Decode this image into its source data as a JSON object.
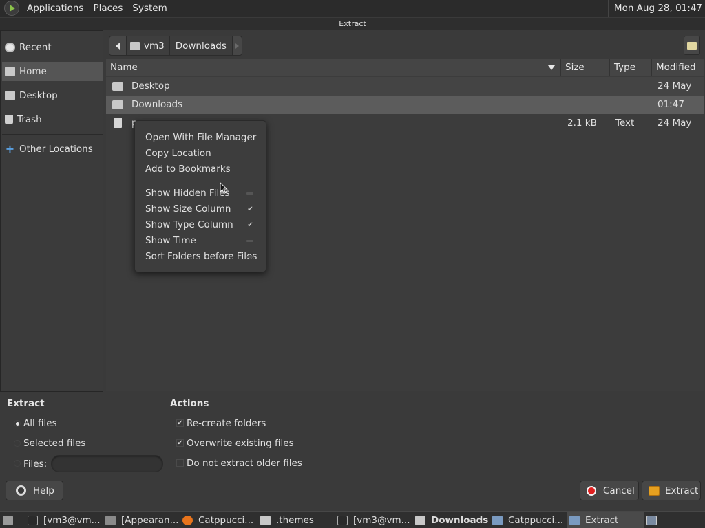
{
  "top_panel": {
    "menus": [
      "Applications",
      "Places",
      "System"
    ],
    "clock": "Mon Aug 28, 01:47"
  },
  "window": {
    "title": "Extract"
  },
  "sidebar": {
    "items": [
      {
        "label": "Recent",
        "icon": "recent-clock-icon"
      },
      {
        "label": "Home",
        "icon": "home-folder-icon",
        "selected": true
      },
      {
        "label": "Desktop",
        "icon": "desktop-folder-icon"
      },
      {
        "label": "Trash",
        "icon": "trash-icon"
      },
      {
        "label": "Other Locations",
        "icon": "plus-icon"
      }
    ]
  },
  "pathbar": {
    "segments": [
      "vm3",
      "Downloads"
    ]
  },
  "filelist": {
    "columns": [
      "Name",
      "Size",
      "Type",
      "Modified"
    ],
    "rows": [
      {
        "name": "Desktop",
        "size": "",
        "type": "",
        "modified": "24 May",
        "icon": "folder-icon"
      },
      {
        "name": "Downloads",
        "size": "",
        "type": "",
        "modified": "01:47",
        "icon": "folder-icon",
        "selected": true
      },
      {
        "name": "p...",
        "size": "2.1 kB",
        "type": "Text",
        "modified": "24 May",
        "icon": "text-file-icon"
      }
    ]
  },
  "context_menu": {
    "items": [
      {
        "label": "Open With File Manager"
      },
      {
        "label": "Copy Location"
      },
      {
        "label": "Add to Bookmarks"
      },
      {
        "label": "Show Hidden Files",
        "checked": false
      },
      {
        "label": "Show Size Column",
        "checked": true
      },
      {
        "label": "Show Type Column",
        "checked": true
      },
      {
        "label": "Show Time",
        "checked": false
      },
      {
        "label": "Sort Folders before Files",
        "checked": false
      }
    ]
  },
  "extract_options": {
    "title": "Extract",
    "all_files": "All files",
    "selected_files": "Selected files",
    "files_label": "Files:",
    "files_value": "",
    "selected": "all_files"
  },
  "actions": {
    "title": "Actions",
    "recreate_folders": "Re-create folders",
    "overwrite": "Overwrite existing files",
    "no_older": "Do not extract older files",
    "recreate_checked": true,
    "overwrite_checked": true,
    "no_older_checked": false
  },
  "buttons": {
    "help": "Help",
    "cancel": "Cancel",
    "extract": "Extract"
  },
  "taskbar": {
    "tasks": [
      {
        "label": "[vm3@vm...",
        "icon": "terminal-icon"
      },
      {
        "label": "[Appearan...",
        "icon": "appearance-icon"
      },
      {
        "label": "Catppucci...",
        "icon": "firefox-icon"
      },
      {
        "label": ".themes",
        "icon": "folder-icon"
      },
      {
        "label": "[vm3@vm...",
        "icon": "terminal-icon"
      },
      {
        "label": "Downloads",
        "icon": "folder-icon",
        "bold": true
      },
      {
        "label": "Catppucci...",
        "icon": "archive-manager-icon"
      },
      {
        "label": "Extract",
        "icon": "archive-manager-icon",
        "active": true
      }
    ]
  }
}
